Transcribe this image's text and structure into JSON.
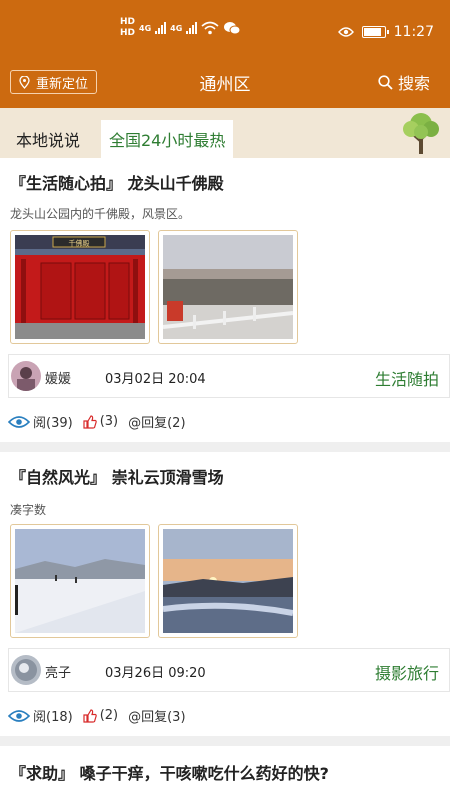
{
  "status_bar": {
    "hd1": "HD",
    "hd2": "HD",
    "network1": "4G",
    "network2": "4G",
    "time": "11:27",
    "battery_level": 0.85
  },
  "nav": {
    "relocate_label": "重新定位",
    "title": "通州区",
    "search_label": "搜索"
  },
  "tabs": [
    {
      "label": "本地说说",
      "active": false
    },
    {
      "label": "全国24小时最热",
      "active": true
    }
  ],
  "posts": [
    {
      "title": "『生活随心拍』 龙头山千佛殿",
      "desc": "龙头山公园内的千佛殿，风景区。",
      "image1_sign": "千佛殿",
      "author": "媛媛",
      "date": "03月02日 20:04",
      "category": "生活随拍",
      "views": "阅(39)",
      "likes": "(3)",
      "replies": "@回复(2)"
    },
    {
      "title": "『自然风光』 崇礼云顶滑雪场",
      "desc": "凑字数",
      "author": "亮子",
      "date": "03月26日 09:20",
      "category": "摄影旅行",
      "views": "阅(18)",
      "likes": "(2)",
      "replies": "@回复(3)"
    },
    {
      "title": "『求助』 嗓子干痒，干咳嗽吃什么药好的快?"
    }
  ],
  "colors": {
    "brand": "#cc6a10",
    "category": "#2e7d32",
    "tab_bg": "#f1e7d6"
  },
  "icons": {
    "relocate": "location-pin-icon",
    "search": "search-icon",
    "views": "eye-icon",
    "likes": "thumbs-up-icon",
    "decor": "tree-icon"
  }
}
